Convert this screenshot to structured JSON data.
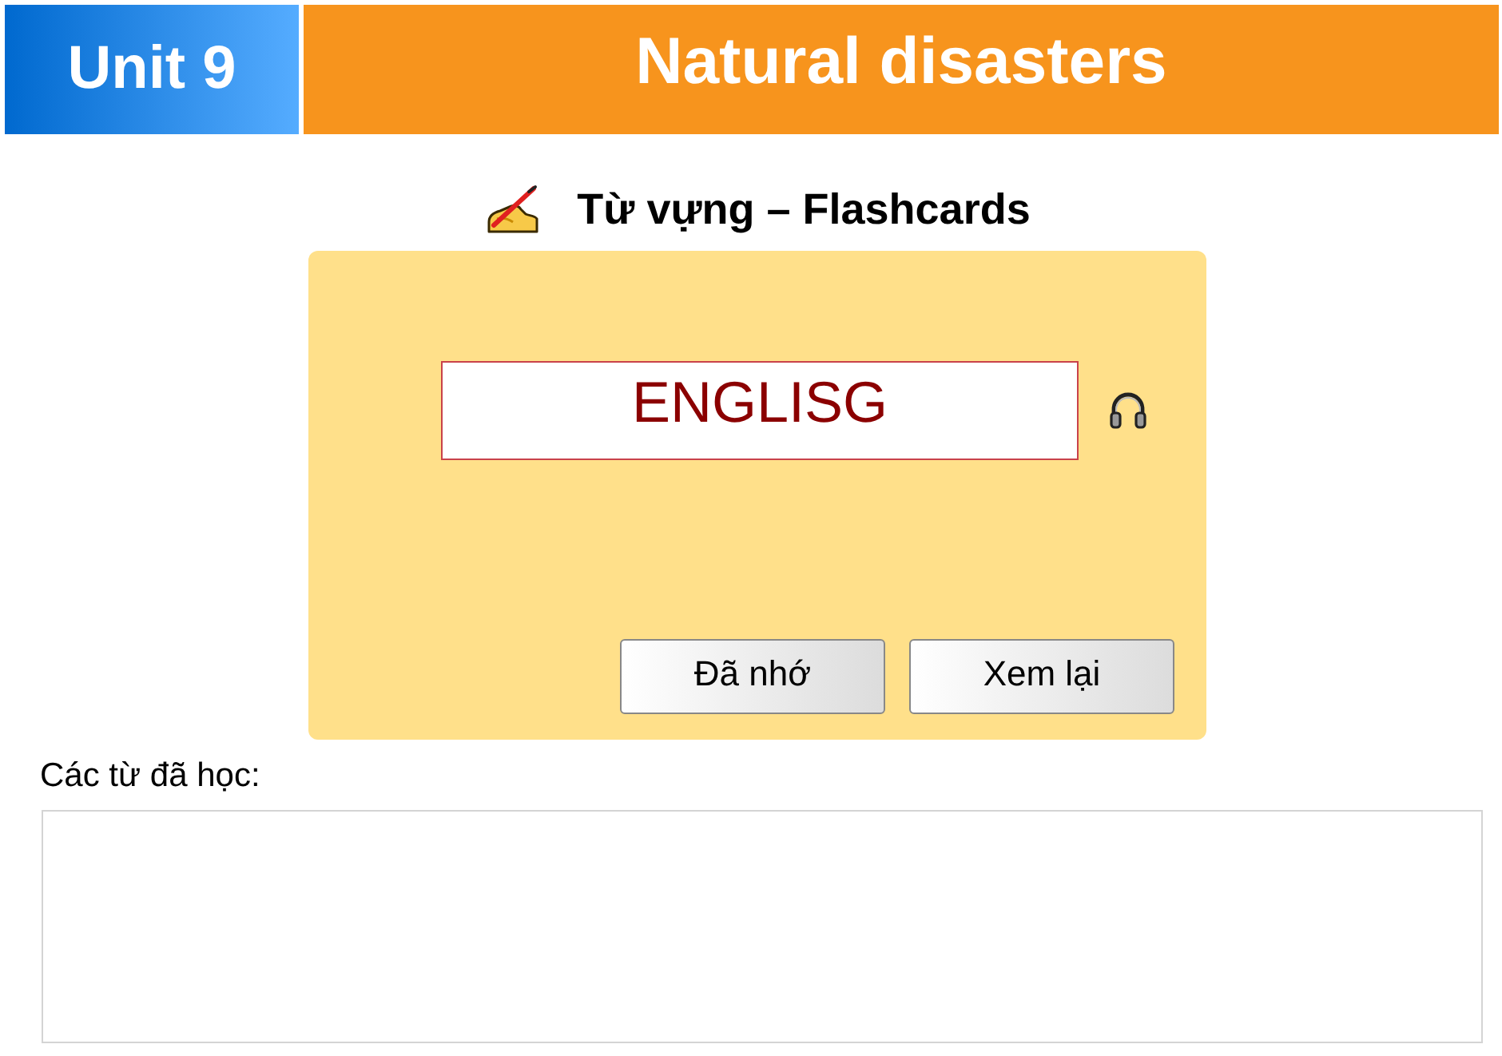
{
  "header": {
    "unit": "Unit 9",
    "title": "Natural disasters"
  },
  "section": {
    "title": "Từ vựng – Flashcards"
  },
  "flashcard": {
    "word": "ENGLISG",
    "buttons": [
      "Đã nhớ",
      "Xem lại"
    ]
  },
  "learned": {
    "label": "Các từ đã học:"
  }
}
